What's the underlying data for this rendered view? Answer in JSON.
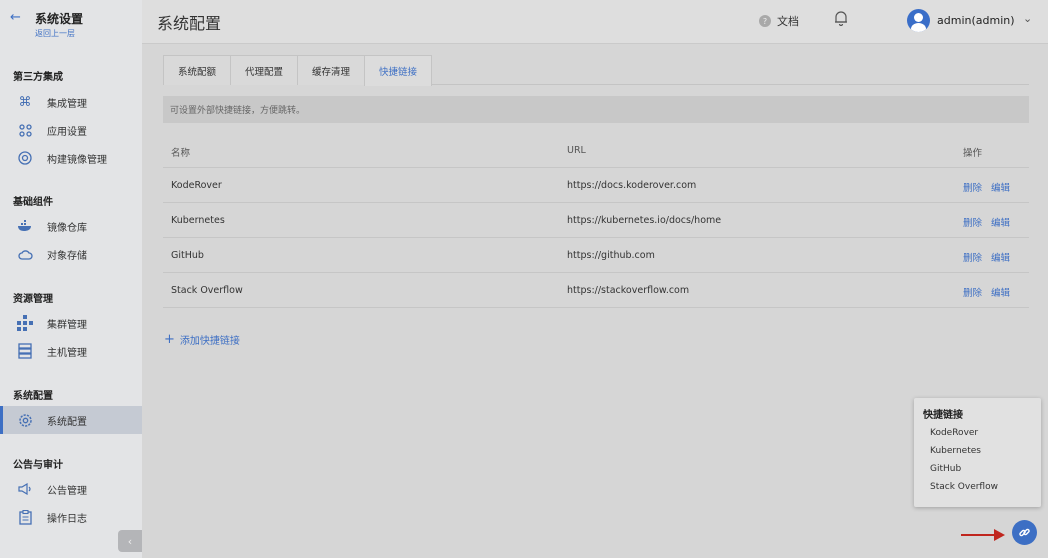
{
  "sidebar": {
    "back_icon": "arrow-left-icon",
    "title": "系统设置",
    "subtitle": "返回上一层",
    "sections": [
      {
        "label": "第三方集成",
        "items": [
          {
            "label": "集成管理",
            "icon": "command-icon"
          },
          {
            "label": "应用设置",
            "icon": "apps-icon"
          },
          {
            "label": "构建镜像管理",
            "icon": "image-build-icon"
          }
        ]
      },
      {
        "label": "基础组件",
        "items": [
          {
            "label": "镜像仓库",
            "icon": "docker-icon"
          },
          {
            "label": "对象存储",
            "icon": "cloud-icon"
          }
        ]
      },
      {
        "label": "资源管理",
        "items": [
          {
            "label": "集群管理",
            "icon": "cluster-icon"
          },
          {
            "label": "主机管理",
            "icon": "server-icon"
          }
        ]
      },
      {
        "label": "系统配置",
        "items": [
          {
            "label": "系统配置",
            "icon": "gear-icon",
            "active": true
          }
        ]
      },
      {
        "label": "公告与审计",
        "items": [
          {
            "label": "公告管理",
            "icon": "announce-icon"
          },
          {
            "label": "操作日志",
            "icon": "log-icon"
          }
        ]
      }
    ],
    "collapse_icon": "chevron-left-icon"
  },
  "header": {
    "title": "系统配置",
    "docs_label": "文档",
    "user_label": "admin(admin)"
  },
  "tabs": [
    {
      "label": "系统配额"
    },
    {
      "label": "代理配置"
    },
    {
      "label": "缓存清理"
    },
    {
      "label": "快捷链接",
      "active": true
    }
  ],
  "notice": "可设置外部快捷链接，方便跳转。",
  "table": {
    "headers": {
      "name": "名称",
      "url": "URL",
      "ops": "操作"
    },
    "rows": [
      {
        "name": "KodeRover",
        "url": "https://docs.koderover.com",
        "delete": "删除",
        "edit": "编辑"
      },
      {
        "name": "Kubernetes",
        "url": "https://kubernetes.io/docs/home",
        "delete": "删除",
        "edit": "编辑"
      },
      {
        "name": "GitHub",
        "url": "https://github.com",
        "delete": "删除",
        "edit": "编辑"
      },
      {
        "name": "Stack Overflow",
        "url": "https://stackoverflow.com",
        "delete": "删除",
        "edit": "编辑"
      }
    ]
  },
  "add_link_label": "添加快捷链接",
  "popover": {
    "title": "快捷链接",
    "items": [
      "KodeRover",
      "Kubernetes",
      "GitHub",
      "Stack Overflow"
    ]
  },
  "colors": {
    "accent": "#3d6fc4",
    "annotation_arrow": "#c0261e"
  }
}
